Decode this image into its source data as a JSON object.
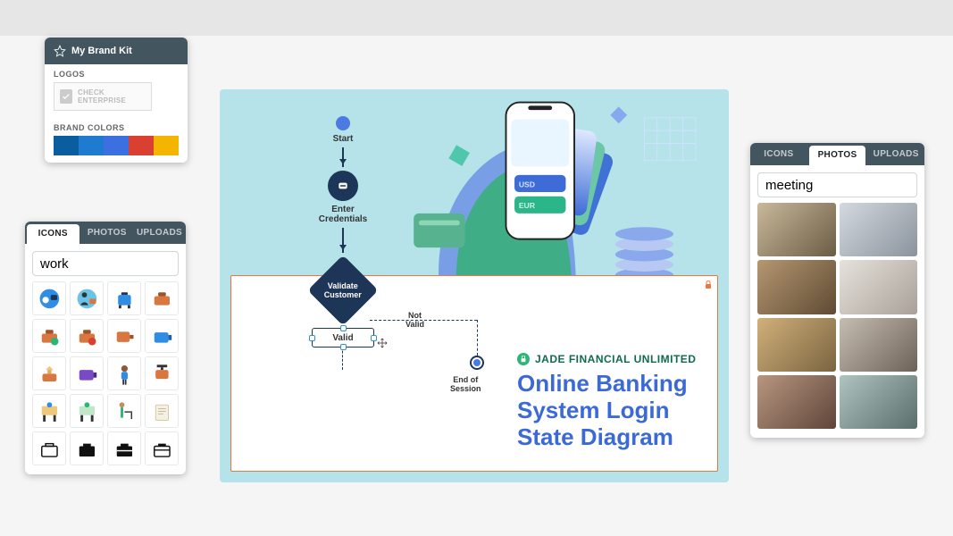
{
  "brandkit": {
    "title": "My Brand Kit",
    "logos_label": "LOGOS",
    "logo_placeholder": "CHECK ENTERPRISE",
    "colors_label": "BRAND COLORS",
    "colors": [
      "#0a5d9e",
      "#1e7bd0",
      "#3c6fe0",
      "#d94032",
      "#f4b400"
    ]
  },
  "library_left": {
    "tabs": {
      "icons": "ICONS",
      "photos": "PHOTOS",
      "uploads": "UPLOADS"
    },
    "active_tab": "icons",
    "search_value": "work"
  },
  "library_right": {
    "tabs": {
      "icons": "ICONS",
      "photos": "PHOTOS",
      "uploads": "UPLOADS"
    },
    "active_tab": "photos",
    "search_value": "meeting"
  },
  "diagram": {
    "start": "Start",
    "enter_credentials": "Enter\nCredentials",
    "validate": "Validate\nCustomer",
    "not_valid": "Not\nValid",
    "valid": "Valid",
    "end": "End of Session",
    "company": "JADE FINANCIAL UNLIMITED",
    "title": "Online Banking System Login State Diagram",
    "phone_labels": {
      "usd": "USD",
      "eur": "EUR"
    }
  }
}
